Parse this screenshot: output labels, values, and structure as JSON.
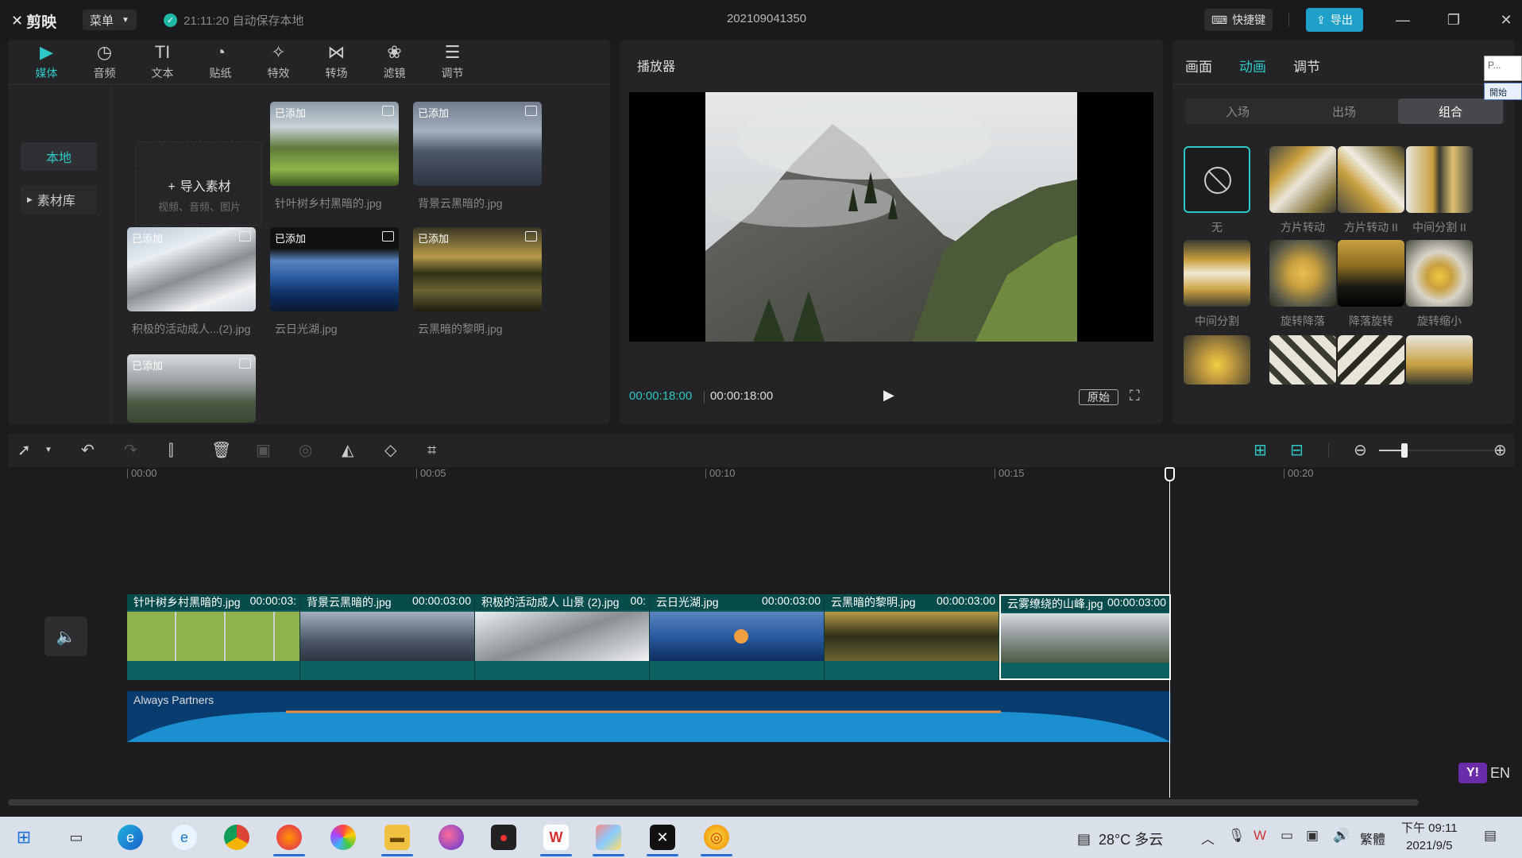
{
  "titlebar": {
    "app_name": "剪映",
    "menu_label": "菜单",
    "save_status": "21:11:20 自动保存本地",
    "project_title": "202109041350",
    "shortcut_label": "快捷键",
    "export_label": "导出"
  },
  "tool_tabs": [
    {
      "label": "媒体",
      "icon": "▶"
    },
    {
      "label": "音频",
      "icon": "◷"
    },
    {
      "label": "文本",
      "icon": "TI"
    },
    {
      "label": "贴纸",
      "icon": "◔"
    },
    {
      "label": "特效",
      "icon": "✧"
    },
    {
      "label": "转场",
      "icon": "⋈"
    },
    {
      "label": "滤镜",
      "icon": "❀"
    },
    {
      "label": "调节",
      "icon": "☰"
    }
  ],
  "media": {
    "nav_local": "本地",
    "nav_library": "素材库",
    "import_label": "导入素材",
    "import_hint": "视频、音频、图片",
    "added_badge": "已添加",
    "assets": [
      {
        "name": "针叶树乡村黑暗的.jpg"
      },
      {
        "name": "背景云黑暗的.jpg"
      },
      {
        "name": "积极的活动成人...(2).jpg"
      },
      {
        "name": "云日光湖.jpg"
      },
      {
        "name": "云黑暗的黎明.jpg"
      }
    ]
  },
  "player": {
    "title": "播放器",
    "time_current": "00:00:18:00",
    "time_total": "00:00:18:00",
    "ratio_label": "原始"
  },
  "anim_panel": {
    "tabs": [
      "画面",
      "动画",
      "调节"
    ],
    "subtabs": [
      "入场",
      "出场",
      "组合"
    ],
    "items": [
      "无",
      "方片转动",
      "方片转动 II",
      "中间分割 II",
      "中间分割",
      "旋转降落",
      "降落旋转",
      "旋转缩小"
    ],
    "ime_text": "P...",
    "ime_button": "開始"
  },
  "timeline": {
    "ruler": [
      "00:00",
      "00:05",
      "00:10",
      "00:15",
      "00:20"
    ],
    "clips": [
      {
        "name": "针叶树乡村黑暗的.jpg",
        "duration": "00:00:03:"
      },
      {
        "name": "背景云黑暗的.jpg",
        "duration": "00:00:03:00"
      },
      {
        "name": "积极的活动成人 山景 (2).jpg",
        "duration": "00:"
      },
      {
        "name": "云日光湖.jpg",
        "duration": "00:00:03:00"
      },
      {
        "name": "云黑暗的黎明.jpg",
        "duration": "00:00:03:00"
      },
      {
        "name": "云雾缭绕的山峰.jpg",
        "duration": "00:00:03:00"
      }
    ],
    "audio_title": "Always Partners"
  },
  "taskbar": {
    "weather": "28°C 多云",
    "lang": "繁體",
    "time": "下午 09:11",
    "date": "2021/9/5",
    "ime_label": "EN"
  },
  "colors": {
    "accent": "#2fc6c6",
    "export": "#1ea0c8",
    "video_track": "#0f5a5a",
    "audio_track": "#083b6e"
  }
}
